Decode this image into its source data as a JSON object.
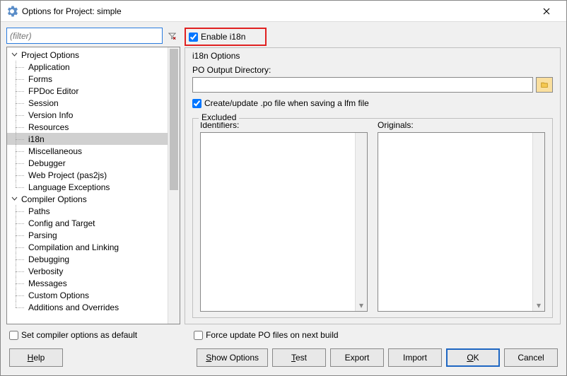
{
  "window": {
    "title": "Options for Project: simple"
  },
  "filter": {
    "placeholder": "(filter)"
  },
  "tree": {
    "groups": [
      {
        "label": "Project Options",
        "expanded": true,
        "items": [
          "Application",
          "Forms",
          "FPDoc Editor",
          "Session",
          "Version Info",
          "Resources",
          "i18n",
          "Miscellaneous",
          "Debugger",
          "Web Project (pas2js)",
          "Language Exceptions"
        ],
        "selected": "i18n"
      },
      {
        "label": "Compiler Options",
        "expanded": true,
        "items": [
          "Paths",
          "Config and Target",
          "Parsing",
          "Compilation and Linking",
          "Debugging",
          "Verbosity",
          "Messages",
          "Custom Options",
          "Additions and Overrides"
        ]
      }
    ]
  },
  "panel": {
    "enable_label": "Enable i18n",
    "enable_checked": true,
    "options_title": "i18n Options",
    "po_dir_label": "PO Output Directory:",
    "po_dir_value": "",
    "create_update_label": "Create/update .po file when saving a lfm file",
    "create_update_checked": true,
    "excluded_title": "Excluded",
    "identifiers_label": "Identifiers:",
    "originals_label": "Originals:"
  },
  "footer": {
    "set_default_label": "Set compiler options as default",
    "set_default_checked": false,
    "force_update_label": "Force update PO files on next build",
    "force_update_checked": false
  },
  "buttons": {
    "help": "Help",
    "show_options": "Show Options",
    "test": "Test",
    "export": "Export",
    "import": "Import",
    "ok": "OK",
    "cancel": "Cancel"
  }
}
